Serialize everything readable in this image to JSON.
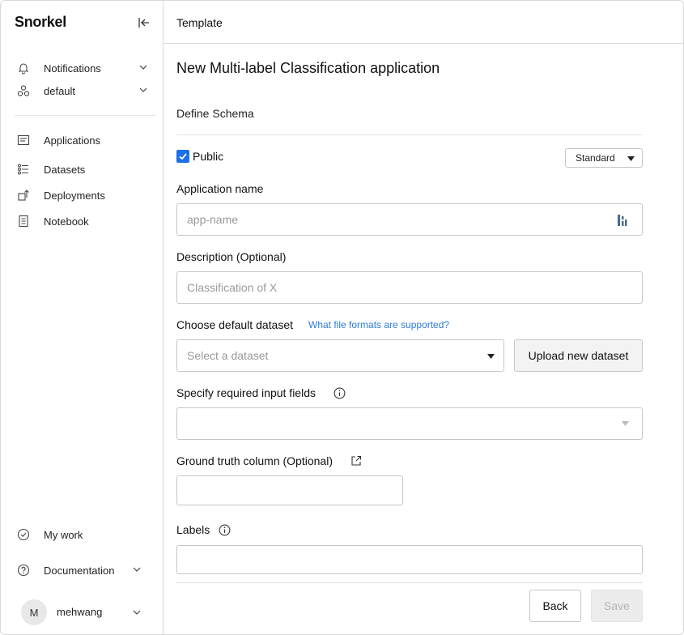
{
  "sidebar": {
    "logo": "Snorkel",
    "top_items": [
      {
        "label": "Notifications",
        "icon": "bell-icon"
      },
      {
        "label": "default",
        "icon": "workspace-icon"
      }
    ],
    "nav_items": [
      {
        "label": "Applications",
        "icon": "applications-icon"
      },
      {
        "label": "Datasets",
        "icon": "datasets-icon"
      },
      {
        "label": "Deployments",
        "icon": "deployments-icon"
      },
      {
        "label": "Notebook",
        "icon": "notebook-icon"
      }
    ],
    "bottom_items": [
      {
        "label": "My work",
        "icon": "check-circle-icon"
      },
      {
        "label": "Documentation",
        "icon": "help-circle-icon"
      }
    ],
    "user": {
      "initial": "M",
      "name": "mehwang"
    }
  },
  "header": {
    "title": "Template"
  },
  "form": {
    "page_title": "New Multi-label Classification application",
    "section_title": "Define Schema",
    "public_label": "Public",
    "public_checked": true,
    "visibility_select": "Standard",
    "app_name_label": "Application name",
    "app_name_placeholder": "app-name",
    "description_label": "Description (Optional)",
    "description_placeholder": "Classification of X",
    "dataset_label": "Choose default dataset",
    "dataset_help_link": "What file formats are supported?",
    "dataset_placeholder": "Select a dataset",
    "upload_button": "Upload new dataset",
    "input_fields_label": "Specify required input fields",
    "ground_truth_label": "Ground truth column (Optional)",
    "labels_label": "Labels"
  },
  "footer": {
    "back_label": "Back",
    "save_label": "Save"
  },
  "colors": {
    "accent": "#1e6fe8",
    "link": "#2f7bd9",
    "border": "#c6c6c6"
  }
}
